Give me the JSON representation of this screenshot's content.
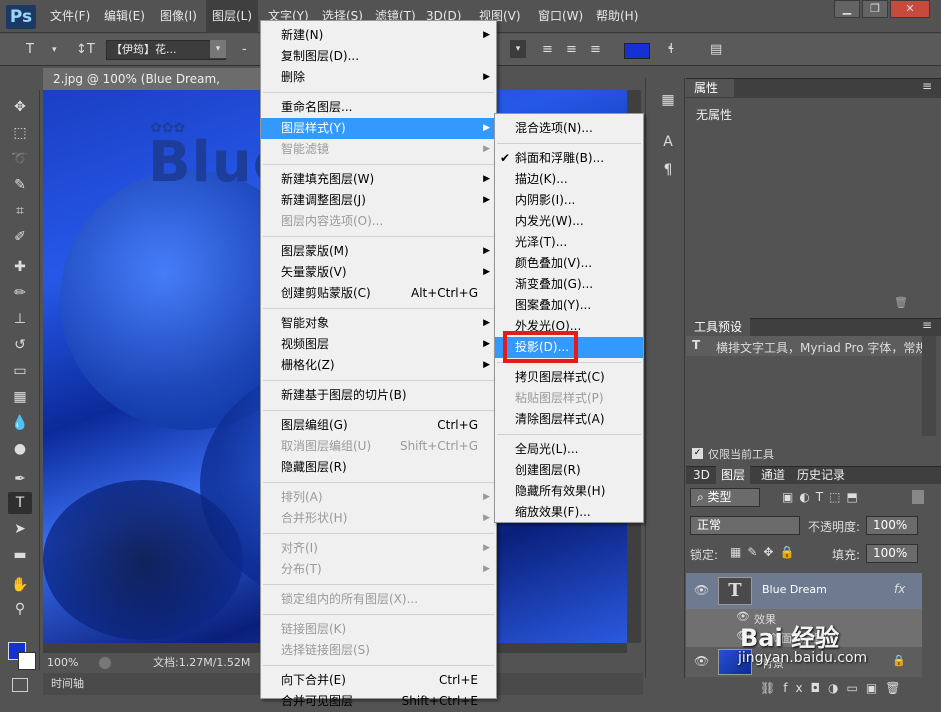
{
  "app": {
    "logo": "Ps"
  },
  "menubar": {
    "items": [
      "文件(F)",
      "编辑(E)",
      "图像(I)",
      "图层(L)",
      "文字(Y)",
      "选择(S)",
      "滤镜(T)",
      "3D(D)",
      "视图(V)",
      "窗口(W)",
      "帮助(H)"
    ],
    "active": "图层(L)"
  },
  "window_controls": {
    "minimize": "▁",
    "restore": "❐",
    "close": "✕"
  },
  "options_bar": {
    "tool_glyph": "T",
    "orient_glyph": "↕T",
    "font_family": "【伊筠】花...",
    "color_hex": "#1531d4"
  },
  "document": {
    "tab_title": "2.jpg @ 100% (Blue Dream, RGB/8#) *",
    "canvas_text": "Blue",
    "zoom": "100%",
    "doc_size": "文档:1.27M/1.52M"
  },
  "timeline": {
    "label": "时间轴"
  },
  "properties_panel": {
    "tab": "属性",
    "content": "无属性"
  },
  "presets_panel": {
    "tab": "工具预设",
    "entry": "横排文字工具，Myriad Pro 字体，常规",
    "current_only_label": "仅限当前工具"
  },
  "layers_panel": {
    "tabs": [
      "3D",
      "图层",
      "通道",
      "历史记录"
    ],
    "active_tab": "图层",
    "filter_label": "类型",
    "blend_mode": "正常",
    "opacity_label": "不透明度:",
    "opacity_value": "100%",
    "lock_label": "锁定:",
    "fill_label": "填充:",
    "fill_value": "100%",
    "layers": [
      {
        "name": "Blue Dream",
        "fx": "fx",
        "type": "text"
      },
      {
        "name": "效果",
        "type": "effects"
      },
      {
        "name": "斜面和浮雕",
        "type": "effect"
      },
      {
        "name": "背景",
        "type": "image"
      }
    ]
  },
  "layer_menu": {
    "items": [
      {
        "label": "新建(N)",
        "submenu": true
      },
      {
        "label": "复制图层(D)..."
      },
      {
        "label": "删除",
        "submenu": true
      },
      {
        "sep": true
      },
      {
        "label": "重命名图层..."
      },
      {
        "label": "图层样式(Y)",
        "submenu": true,
        "highlight": true
      },
      {
        "label": "智能滤镜",
        "submenu": true,
        "disabled": true
      },
      {
        "sep": true
      },
      {
        "label": "新建填充图层(W)",
        "submenu": true
      },
      {
        "label": "新建调整图层(J)",
        "submenu": true
      },
      {
        "label": "图层内容选项(O)...",
        "disabled": true
      },
      {
        "sep": true
      },
      {
        "label": "图层蒙版(M)",
        "submenu": true
      },
      {
        "label": "矢量蒙版(V)",
        "submenu": true
      },
      {
        "label": "创建剪贴蒙版(C)",
        "shortcut": "Alt+Ctrl+G"
      },
      {
        "sep": true
      },
      {
        "label": "智能对象",
        "submenu": true
      },
      {
        "label": "视频图层",
        "submenu": true
      },
      {
        "label": "栅格化(Z)",
        "submenu": true
      },
      {
        "sep": true
      },
      {
        "label": "新建基于图层的切片(B)"
      },
      {
        "sep": true
      },
      {
        "label": "图层编组(G)",
        "shortcut": "Ctrl+G"
      },
      {
        "label": "取消图层编组(U)",
        "shortcut": "Shift+Ctrl+G",
        "disabled": true
      },
      {
        "label": "隐藏图层(R)"
      },
      {
        "sep": true
      },
      {
        "label": "排列(A)",
        "submenu": true,
        "disabled": true
      },
      {
        "label": "合并形状(H)",
        "submenu": true,
        "disabled": true
      },
      {
        "sep": true
      },
      {
        "label": "对齐(I)",
        "submenu": true,
        "disabled": true
      },
      {
        "label": "分布(T)",
        "submenu": true,
        "disabled": true
      },
      {
        "sep": true
      },
      {
        "label": "锁定组内的所有图层(X)...",
        "disabled": true
      },
      {
        "sep": true
      },
      {
        "label": "链接图层(K)",
        "disabled": true
      },
      {
        "label": "选择链接图层(S)",
        "disabled": true
      },
      {
        "sep": true
      },
      {
        "label": "向下合并(E)",
        "shortcut": "Ctrl+E"
      },
      {
        "label": "合并可见图层",
        "shortcut": "Shift+Ctrl+E"
      }
    ]
  },
  "style_submenu": {
    "items": [
      {
        "label": "混合选项(N)..."
      },
      {
        "sep": true
      },
      {
        "label": "斜面和浮雕(B)...",
        "checked": true
      },
      {
        "label": "描边(K)..."
      },
      {
        "label": "内阴影(I)..."
      },
      {
        "label": "内发光(W)..."
      },
      {
        "label": "光泽(T)..."
      },
      {
        "label": "颜色叠加(V)..."
      },
      {
        "label": "渐变叠加(G)..."
      },
      {
        "label": "图案叠加(Y)..."
      },
      {
        "label": "外发光(O)..."
      },
      {
        "label": "投影(D)...",
        "highlight": true
      },
      {
        "sep": true
      },
      {
        "label": "拷贝图层样式(C)"
      },
      {
        "label": "粘贴图层样式(P)",
        "disabled": true
      },
      {
        "label": "清除图层样式(A)"
      },
      {
        "sep": true
      },
      {
        "label": "全局光(L)..."
      },
      {
        "label": "创建图层(R)"
      },
      {
        "label": "隐藏所有效果(H)"
      },
      {
        "label": "缩放效果(F)..."
      }
    ]
  },
  "watermark": {
    "brand": "Bai 经验",
    "url": "jingyan.baidu.com"
  }
}
